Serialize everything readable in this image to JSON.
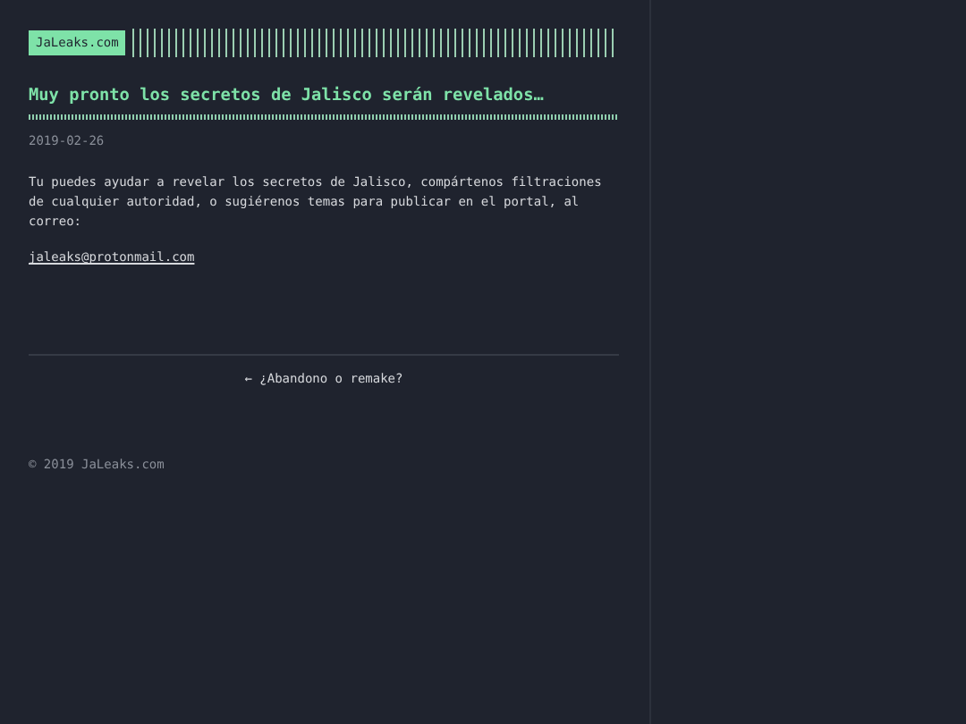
{
  "site_logo": "JaLeaks.com",
  "post": {
    "title": "Muy pronto los secretos de Jalisco serán revelados…",
    "date": "2019-02-26",
    "body": "Tu puedes ayudar a revelar los secretos de Jalisco, compártenos filtraciones de cualquier autoridad, o sugiérenos temas para publicar en el portal, al correo:",
    "email": "jaleaks@protonmail.com"
  },
  "nav_link": "← ¿Abandono o remake?",
  "footer": "© 2019 JaLeaks.com"
}
